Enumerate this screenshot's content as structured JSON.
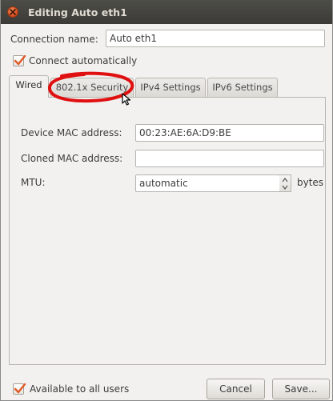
{
  "window": {
    "title": "Editing Auto eth1"
  },
  "connection": {
    "name_label": "Connection name:",
    "name_value": "Auto eth1",
    "connect_automatically_label": "Connect automatically",
    "connect_automatically_checked": true
  },
  "tabs": [
    {
      "label": "Wired",
      "active": true
    },
    {
      "label": "802.1x Security",
      "active": false
    },
    {
      "label": "IPv4 Settings",
      "active": false
    },
    {
      "label": "IPv6 Settings",
      "active": false
    }
  ],
  "wired": {
    "device_mac_label": "Device MAC address:",
    "device_mac_value": "00:23:AE:6A:D9:BE",
    "cloned_mac_label": "Cloned MAC address:",
    "cloned_mac_value": "",
    "mtu_label": "MTU:",
    "mtu_value": "automatic",
    "mtu_unit": "bytes"
  },
  "footer": {
    "available_all_users_label": "Available to all users",
    "available_all_users_checked": true,
    "cancel_label": "Cancel",
    "save_label": "Save..."
  },
  "colors": {
    "titlebar": "#3c3b37",
    "close_button": "#e05a27",
    "checkmark": "#e05a27",
    "annotation": "#e01010",
    "window_bg": "#f2f1f0"
  },
  "icons": {
    "close": "close-icon",
    "checkmark": "checkmark-icon",
    "spin_up": "chevron-up-icon",
    "spin_down": "chevron-down-icon",
    "cursor": "mouse-pointer-icon"
  }
}
